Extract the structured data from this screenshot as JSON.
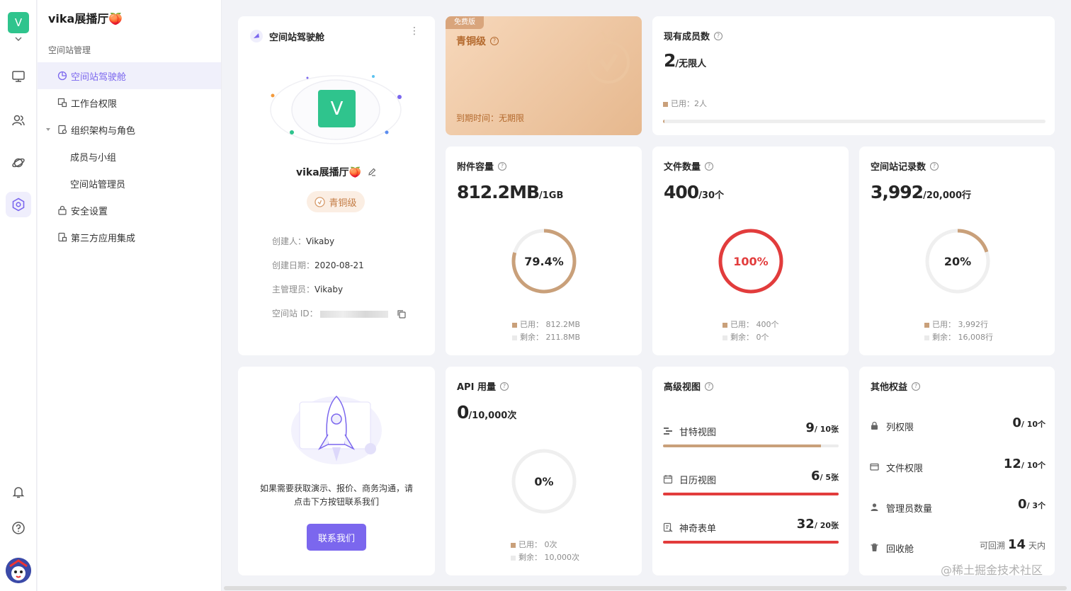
{
  "rail": {
    "space_initial": "V"
  },
  "sidebar": {
    "workspace_name": "vika展播厅🍑",
    "section": "空间站管理",
    "items": [
      {
        "label": "空间站驾驶舱",
        "active": true
      },
      {
        "label": "工作台权限"
      },
      {
        "label": "组织架构与角色"
      },
      {
        "label": "成员与小组"
      },
      {
        "label": "空间站管理员"
      },
      {
        "label": "安全设置"
      },
      {
        "label": "第三方应用集成"
      }
    ]
  },
  "overview": {
    "title": "空间站驾驶舱",
    "space_initial": "V",
    "name": "vika展播厅🍑",
    "tier": "青铜级",
    "rows": [
      {
        "k": "创建人：",
        "v": "Vikaby"
      },
      {
        "k": "创建日期：",
        "v": "2020-08-21"
      },
      {
        "k": "主管理员：",
        "v": "Vikaby"
      },
      {
        "k": "空间站 ID：",
        "v": ""
      }
    ]
  },
  "plan": {
    "badge": "免费版",
    "tier": "青铜级",
    "expire": "到期时间：无期限"
  },
  "members": {
    "title": "现有成员数",
    "value": "2",
    "unit": "/无限人",
    "used": "已用：2人",
    "fill_fraction": 0.003
  },
  "attachments": {
    "title": "附件容量",
    "value": "812.2MB",
    "unit": "/1GB",
    "percent_label": "79.4%",
    "percent": 79.4,
    "used": "已用：  812.2MB",
    "left": "剩余：  211.8MB"
  },
  "files": {
    "title": "文件数量",
    "value": "400",
    "unit": "/30个",
    "percent_label": "100%",
    "percent": 100,
    "used": "已用：  400个",
    "left": "剩余：  0个"
  },
  "records": {
    "title": "空间站记录数",
    "value": "3,992",
    "unit": "/20,000行",
    "percent_label": "20%",
    "percent": 20,
    "used": "已用：  3,992行",
    "left": "剩余：  16,008行"
  },
  "contact": {
    "text1": "如果需要获取演示、报价、商务沟通，请",
    "text2": "点击下方按钮联系我们",
    "button": "联系我们"
  },
  "api": {
    "title": "API 用量",
    "value": "0",
    "unit": "/10,000次",
    "percent_label": "0%",
    "percent": 0,
    "used": "已用：  0次",
    "left": "剩余：  10,000次"
  },
  "advanced": {
    "title": "高级视图",
    "rows": [
      {
        "name": "甘特视图",
        "value": "9",
        "unit": "/ 10张",
        "fraction": 0.9
      },
      {
        "name": "日历视图",
        "value": "6",
        "unit": "/ 5张",
        "fraction": 1
      },
      {
        "name": "神奇表单",
        "value": "32",
        "unit": "/ 20张",
        "fraction": 1
      }
    ]
  },
  "others": {
    "title": "其他权益",
    "rows": [
      {
        "name": "列权限",
        "value": "0",
        "unit": "/ 10个"
      },
      {
        "name": "文件权限",
        "value": "12",
        "unit": "/ 10个"
      },
      {
        "name": "管理员数量",
        "value": "0",
        "unit": "/ 3个"
      },
      {
        "name": "回收舱",
        "prefix": "可回溯",
        "value": "14",
        "unit": "天内"
      }
    ]
  },
  "watermark": "@稀土掘金技术社区",
  "colors": {
    "accent": "#7b67ee",
    "bronze": "#c9a07a",
    "danger": "#e83d3d",
    "green": "#2fc48d"
  }
}
